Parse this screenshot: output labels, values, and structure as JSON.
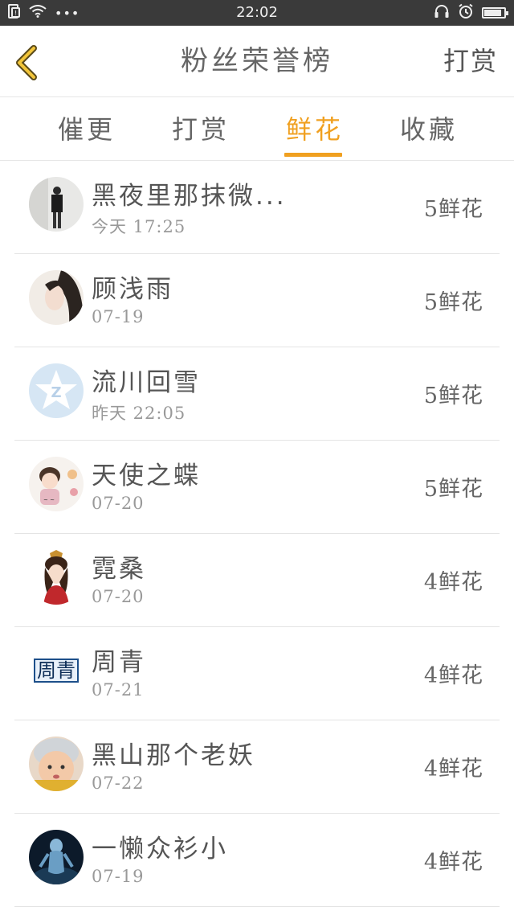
{
  "status_bar": {
    "time": "22:02",
    "dots": "•••"
  },
  "header": {
    "title": "粉丝荣誉榜",
    "right_button": "打赏"
  },
  "tabs": [
    {
      "label": "催更",
      "active": false
    },
    {
      "label": "打赏",
      "active": false
    },
    {
      "label": "鲜花",
      "active": true
    },
    {
      "label": "收藏",
      "active": false
    }
  ],
  "accent_color": "#f0a020",
  "fans": [
    {
      "name": "黑夜里那抹微...",
      "date": "今天 17:25",
      "count": "5",
      "unit": "鲜花",
      "avatar": "photo-girl"
    },
    {
      "name": "顾浅雨",
      "date": "07-19",
      "count": "5",
      "unit": "鲜花",
      "avatar": "photo-woman"
    },
    {
      "name": "流川回雪",
      "date": "昨天 22:05",
      "count": "5",
      "unit": "鲜花",
      "avatar": "qq-default-avatar"
    },
    {
      "name": "天使之蝶",
      "date": "07-20",
      "count": "5",
      "unit": "鲜花",
      "avatar": "cartoon-girl"
    },
    {
      "name": "霓桑",
      "date": "07-20",
      "count": "4",
      "unit": "鲜花",
      "avatar": "illustration-lady"
    },
    {
      "name": "周青",
      "date": "07-21",
      "count": "4",
      "unit": "鲜花",
      "avatar": "text-avatar",
      "avatar_text": "周青"
    },
    {
      "name": "黑山那个老妖",
      "date": "07-22",
      "count": "4",
      "unit": "鲜花",
      "avatar": "photo-baby"
    },
    {
      "name": "一懒众衫小",
      "date": "07-19",
      "count": "4",
      "unit": "鲜花",
      "avatar": "photo-dark"
    }
  ]
}
